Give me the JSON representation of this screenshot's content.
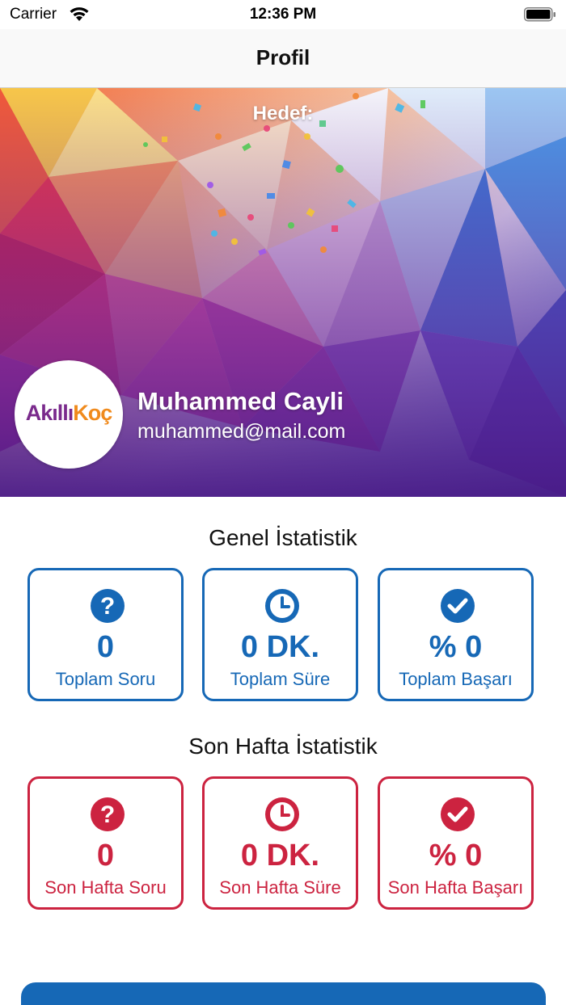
{
  "status_bar": {
    "carrier": "Carrier",
    "time": "12:36 PM",
    "icons": [
      "wifi-icon",
      "battery-icon"
    ]
  },
  "nav": {
    "title": "Profil"
  },
  "banner": {
    "goal_label": "Hedef:",
    "avatar_logo": {
      "part1": "Akıllı",
      "part2": "Koç"
    },
    "user_name": "Muhammed Cayli",
    "user_email": "muhammed@mail.com"
  },
  "general_stats": {
    "title": "Genel İstatistik",
    "color": "#1668b6",
    "cards": [
      {
        "icon": "question-circle-icon",
        "value": "0",
        "label": "Toplam Soru"
      },
      {
        "icon": "clock-icon",
        "value": "0 DK.",
        "label": "Toplam Süre"
      },
      {
        "icon": "check-circle-icon",
        "value": "% 0",
        "label": "Toplam Başarı"
      }
    ]
  },
  "weekly_stats": {
    "title": "Son Hafta İstatistik",
    "color": "#cc2340",
    "cards": [
      {
        "icon": "question-circle-icon",
        "value": "0",
        "label": "Son Hafta Soru"
      },
      {
        "icon": "clock-icon",
        "value": "0 DK.",
        "label": "Son Hafta Süre"
      },
      {
        "icon": "check-circle-icon",
        "value": "% 0",
        "label": "Son Hafta Başarı"
      }
    ]
  },
  "colors": {
    "primary_blue": "#1668b6",
    "accent_red": "#cc2340"
  }
}
